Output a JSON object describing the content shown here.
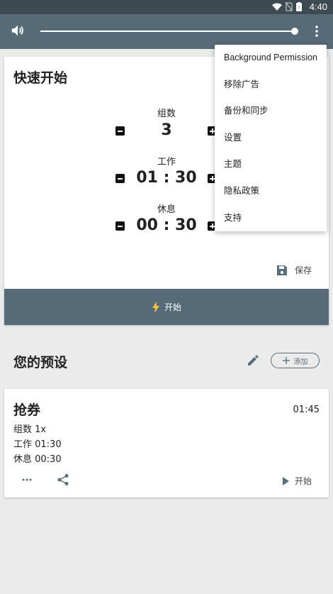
{
  "status_bar": {
    "time": "4:40"
  },
  "app_bar": {
    "volume_level_percent": 100
  },
  "quick_start": {
    "title": "快速开始",
    "sets_label": "组数",
    "sets_value": "3",
    "work_label": "工作",
    "work_value": "01 : 30",
    "rest_label": "休息",
    "rest_value": "00 : 30",
    "save_label": "保存",
    "start_label": "开始"
  },
  "presets": {
    "title": "您的预设",
    "add_label": "添加",
    "items": [
      {
        "name": "抢券",
        "total": "01:45",
        "sets_line": "组数  1x",
        "work_line": "工作  01:30",
        "rest_line": "休息  00:30",
        "start_label": "开始"
      }
    ]
  },
  "menu": {
    "items": [
      {
        "label": "Background Permission"
      },
      {
        "label": "移除广告"
      },
      {
        "label": "备份和同步"
      },
      {
        "label": "设置"
      },
      {
        "label": "主题"
      },
      {
        "label": "隐私政策"
      },
      {
        "label": "支持"
      }
    ]
  },
  "colors": {
    "app_bar": "#566b77",
    "status_bar": "#3c4a52",
    "lightning": "#f5c242",
    "background": "#ebebeb"
  }
}
